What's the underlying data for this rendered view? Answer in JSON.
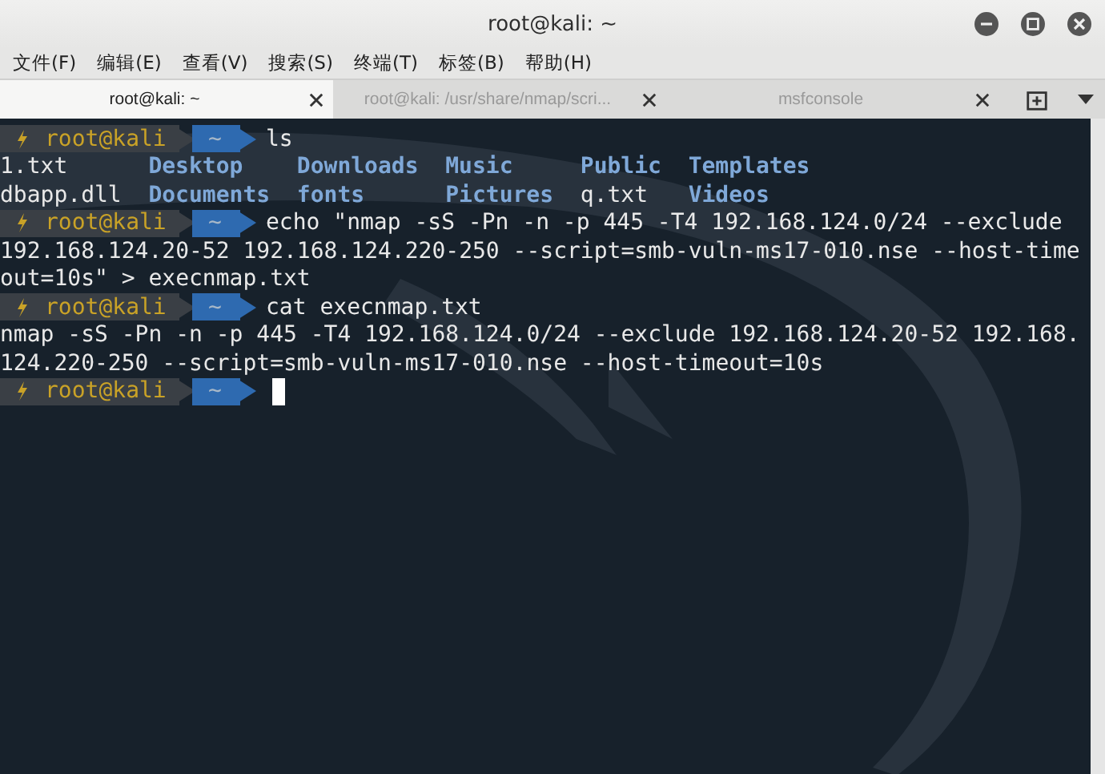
{
  "window": {
    "title": "root@kali: ~"
  },
  "menu": [
    "文件(F)",
    "编辑(E)",
    "查看(V)",
    "搜索(S)",
    "终端(T)",
    "标签(B)",
    "帮助(H)"
  ],
  "tabs": [
    {
      "label": "root@kali: ~",
      "selected": true
    },
    {
      "label": "root@kali: /usr/share/nmap/scri...",
      "selected": false
    },
    {
      "label": "msfconsole",
      "selected": false
    }
  ],
  "terminal": {
    "lines": [
      {
        "kind": "prompt",
        "user": "root@kali",
        "dir": "~",
        "command": "ls"
      },
      {
        "kind": "listing",
        "cells": [
          {
            "text": "1.txt",
            "kind": "file"
          },
          {
            "text": "Desktop",
            "kind": "dir"
          },
          {
            "text": "Downloads",
            "kind": "dir"
          },
          {
            "text": "Music",
            "kind": "dir"
          },
          {
            "text": "Public",
            "kind": "dir"
          },
          {
            "text": "Templates",
            "kind": "dir"
          }
        ]
      },
      {
        "kind": "listing",
        "cells": [
          {
            "text": "dbapp.dll",
            "kind": "file"
          },
          {
            "text": "Documents",
            "kind": "dir"
          },
          {
            "text": "fonts",
            "kind": "dir"
          },
          {
            "text": "Pictures",
            "kind": "dir"
          },
          {
            "text": "q.txt",
            "kind": "file"
          },
          {
            "text": "Videos",
            "kind": "dir"
          }
        ]
      },
      {
        "kind": "prompt",
        "user": "root@kali",
        "dir": "~",
        "command": "echo \"nmap -sS -Pn -n -p 445 -T4 192.168.124.0/24 --exclude"
      },
      {
        "kind": "output",
        "text": "192.168.124.20-52 192.168.124.220-250 --script=smb-vuln-ms17-010.nse --host-time"
      },
      {
        "kind": "output",
        "text": "out=10s\" > execnmap.txt"
      },
      {
        "kind": "prompt",
        "user": "root@kali",
        "dir": "~",
        "command": "cat execnmap.txt"
      },
      {
        "kind": "output",
        "text": "nmap -sS -Pn -n -p 445 -T4 192.168.124.0/24 --exclude 192.168.124.20-52 192.168."
      },
      {
        "kind": "output",
        "text": "124.220-250 --script=smb-vuln-ms17-010.nse --host-timeout=10s"
      },
      {
        "kind": "prompt",
        "user": "root@kali",
        "dir": "~",
        "cursor": true
      }
    ]
  }
}
